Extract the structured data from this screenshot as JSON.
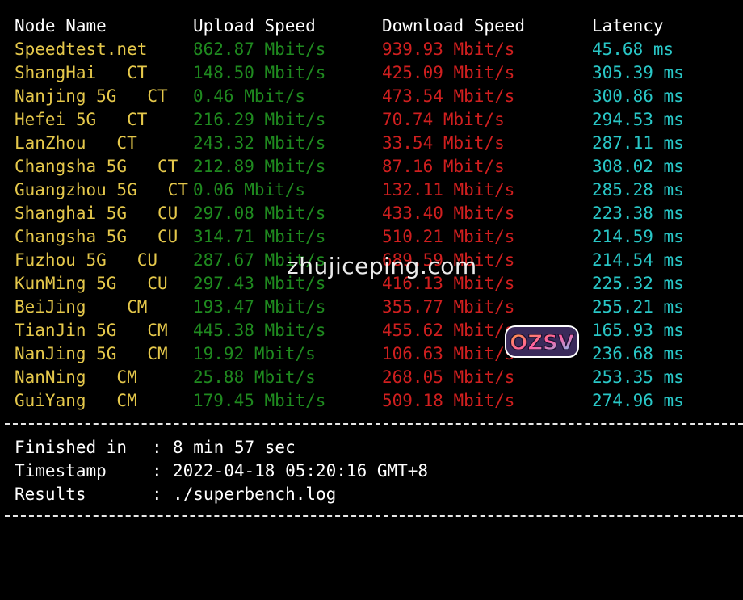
{
  "headers": {
    "node": "Node Name",
    "upload": "Upload Speed",
    "download": "Download Speed",
    "latency": "Latency"
  },
  "rows": [
    {
      "node": "Speedtest.net",
      "upload": "862.87 Mbit/s",
      "download": "939.93 Mbit/s",
      "latency": "45.68 ms"
    },
    {
      "node": "ShangHai   CT",
      "upload": "148.50 Mbit/s",
      "download": "425.09 Mbit/s",
      "latency": "305.39 ms"
    },
    {
      "node": "Nanjing 5G   CT",
      "upload": "0.46 Mbit/s",
      "download": "473.54 Mbit/s",
      "latency": "300.86 ms"
    },
    {
      "node": "Hefei 5G   CT",
      "upload": "216.29 Mbit/s",
      "download": "70.74 Mbit/s",
      "latency": "294.53 ms"
    },
    {
      "node": "LanZhou   CT",
      "upload": "243.32 Mbit/s",
      "download": "33.54 Mbit/s",
      "latency": "287.11 ms"
    },
    {
      "node": "Changsha 5G   CT",
      "upload": "212.89 Mbit/s",
      "download": "87.16 Mbit/s",
      "latency": "308.02 ms"
    },
    {
      "node": "Guangzhou 5G   CT",
      "upload": "0.06 Mbit/s",
      "download": "132.11 Mbit/s",
      "latency": "285.28 ms"
    },
    {
      "node": "Shanghai 5G   CU",
      "upload": "297.08 Mbit/s",
      "download": "433.40 Mbit/s",
      "latency": "223.38 ms"
    },
    {
      "node": "Changsha 5G   CU",
      "upload": "314.71 Mbit/s",
      "download": "510.21 Mbit/s",
      "latency": "214.59 ms"
    },
    {
      "node": "Fuzhou 5G   CU",
      "upload": "287.67 Mbit/s",
      "download": "689.59 Mbit/s",
      "latency": "214.54 ms"
    },
    {
      "node": "KunMing 5G   CU",
      "upload": "297.43 Mbit/s",
      "download": "416.13 Mbit/s",
      "latency": "225.32 ms"
    },
    {
      "node": "BeiJing    CM",
      "upload": "193.47 Mbit/s",
      "download": "355.77 Mbit/s",
      "latency": "255.21 ms"
    },
    {
      "node": "TianJin 5G   CM",
      "upload": "445.38 Mbit/s",
      "download": "455.62 Mbit/s",
      "latency": "165.93 ms"
    },
    {
      "node": "NanJing 5G   CM",
      "upload": "19.92 Mbit/s",
      "download": "106.63 Mbit/s",
      "latency": "236.68 ms"
    },
    {
      "node": "NanNing   CM",
      "upload": "25.88 Mbit/s",
      "download": "268.05 Mbit/s",
      "latency": "253.35 ms"
    },
    {
      "node": "GuiYang   CM",
      "upload": "179.45 Mbit/s",
      "download": "509.18 Mbit/s",
      "latency": "274.96 ms"
    }
  ],
  "summary": {
    "finished": {
      "key": "Finished in",
      "value": "8 min 57 sec"
    },
    "timestamp": {
      "key": "Timestamp",
      "value": "2022-04-18 05:20:16 GMT+8"
    },
    "results": {
      "key": "Results",
      "value": "./superbench.log"
    }
  },
  "summary_colon": ":",
  "watermark": "zhujiceping.com",
  "logo_text": "OZSV",
  "colors": {
    "background": "#000000",
    "node": "#e5c84b",
    "upload": "#1f8a1f",
    "download": "#d01f1f",
    "latency": "#29c7c7",
    "text": "#ffffff"
  },
  "icons": {
    "logo": "ozsv-logo-icon"
  }
}
